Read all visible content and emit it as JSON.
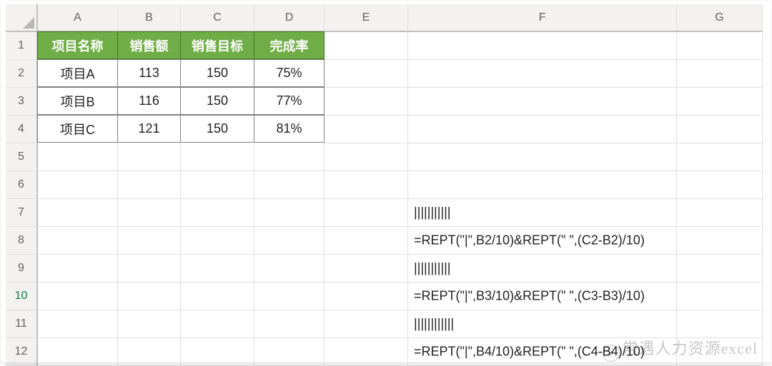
{
  "columns": [
    "A",
    "B",
    "C",
    "D",
    "E",
    "F",
    "G"
  ],
  "row_count": 12,
  "active_row": 10,
  "table": {
    "headers": {
      "A": "项目名称",
      "B": "销售额",
      "C": "销售目标",
      "D": "完成率"
    },
    "rows": [
      {
        "A": "项目A",
        "B": "113",
        "C": "150",
        "D": "75%"
      },
      {
        "A": "项目B",
        "B": "116",
        "C": "150",
        "D": "77%"
      },
      {
        "A": "项目C",
        "B": "121",
        "C": "150",
        "D": "81%"
      }
    ]
  },
  "cells": {
    "F7": "|||||||||||",
    "F8": " =REPT(\"|\",B2/10)&REPT(\" \",(C2-B2)/10)",
    "F9": "|||||||||||",
    "F10": " =REPT(\"|\",B3/10)&REPT(\" \",(C3-B3)/10)",
    "F11": "||||||||||||",
    "F12": " =REPT(\"|\",B4/10)&REPT(\" \",(C4-B4)/10)"
  },
  "watermark": "常遇人力资源excel"
}
